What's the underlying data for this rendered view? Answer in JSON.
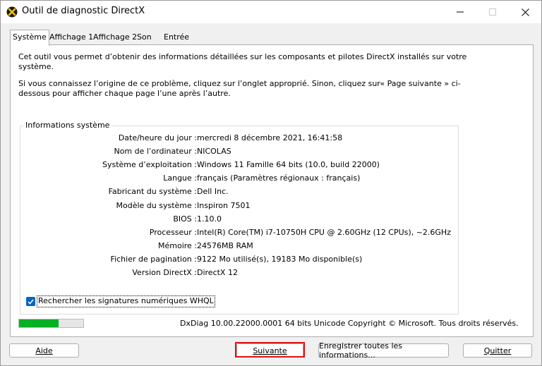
{
  "window": {
    "title": "Outil de diagnostic DirectX",
    "minimize_glyph": "—",
    "maximize_glyph": "☐",
    "close_glyph": "✕"
  },
  "tabs": [
    {
      "label": "Système"
    },
    {
      "label": "Affichage 1"
    },
    {
      "label": "Affichage 2"
    },
    {
      "label": "Son"
    },
    {
      "label": "Entrée"
    }
  ],
  "intro": {
    "line1": "Cet outil vous permet d’obtenir des informations détaillées sur les composants et pilotes DirectX installés sur votre système.",
    "line2": "Si vous connaissez l’origine de ce problème, cliquez sur l’onglet approprié. Sinon, cliquez sur« Page suivante » ci-dessous pour afficher chaque page l’une après l’autre."
  },
  "system_info": {
    "group_title": "Informations système",
    "rows": [
      {
        "label": "Date/heure du jour :",
        "value": "mercredi 8 décembre 2021, 16:41:58"
      },
      {
        "label": "Nom de l’ordinateur :",
        "value": "NICOLAS"
      },
      {
        "label": "Système d’exploitation :",
        "value": "Windows 11 Famille 64 bits (10.0, build 22000)"
      },
      {
        "label": "Langue :",
        "value": "français (Paramètres régionaux : français)"
      },
      {
        "label": "Fabricant du système :",
        "value": "Dell Inc."
      },
      {
        "label": "Modèle du système :",
        "value": "Inspiron 7501"
      },
      {
        "label": "BIOS :",
        "value": "1.10.0"
      },
      {
        "label": "Processeur :",
        "value": "Intel(R) Core(TM) i7-10750H CPU @ 2.60GHz (12 CPUs), ~2.6GHz"
      },
      {
        "label": "Mémoire :",
        "value": "24576MB RAM"
      },
      {
        "label": "Fichier de pagination :",
        "value": "9122 Mo utilisé(s), 19183 Mo disponible(s)"
      },
      {
        "label": "Version DirectX :",
        "value": "DirectX 12"
      }
    ]
  },
  "whql_checkbox": {
    "label": "Rechercher les signatures numériques WHQL",
    "checked": true
  },
  "progress": {
    "fraction": 0.62,
    "color": "#06b025"
  },
  "footer_text": "DxDiag 10.00.22000.0001 64 bits Unicode Copyright © Microsoft. Tous droits réservés.",
  "buttons": {
    "help": "Aide",
    "next": "Suivante",
    "save_all": "Enregistrer toutes les informations...",
    "quit": "Quitter"
  },
  "colors": {
    "accent": "#0067c0",
    "highlight": "#e01010"
  }
}
